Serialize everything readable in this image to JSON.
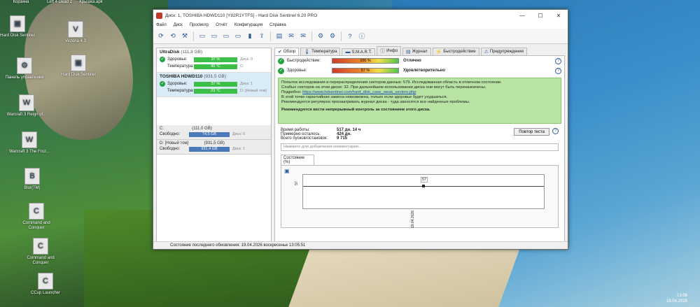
{
  "desktop": {
    "top_labels": [
      "Корзина",
      "Left 4 Dead 2",
      "Крышка.apk"
    ],
    "icons": [
      {
        "label": "Hard Disk Sentinel",
        "glyph": "▣"
      },
      {
        "label": "Victoria 4.3",
        "glyph": "V"
      },
      {
        "label": "Hard Disk Sentinel",
        "glyph": "▣"
      },
      {
        "label": "Панель управления",
        "glyph": "⚙"
      },
      {
        "label": "Warcraft 3 Reign of...",
        "glyph": "W"
      },
      {
        "label": "Warcraft 3 The Froz...",
        "glyph": "W"
      },
      {
        "label": "Blur(TM)",
        "glyph": "B"
      },
      {
        "label": "Command and Conquer",
        "glyph": "C"
      },
      {
        "label": "Command and Conquer",
        "glyph": "C"
      },
      {
        "label": "CCup Launcher",
        "glyph": "C"
      }
    ],
    "clock": {
      "time": "13:06",
      "date": "19.04.2026"
    }
  },
  "window": {
    "title": "Диск: 1, TOSHIBA HDWD110 [Y82R1YTFS] - Hard Disk Sentinel 6.20 PRO",
    "controls": [
      "—",
      "☐",
      "✕"
    ],
    "menu": [
      "Файл",
      "Диск",
      "Просмотр",
      "Отчёт",
      "Конфигурация",
      "Справка"
    ],
    "toolbar_icons": [
      "refresh-icon",
      "refresh-all-icon",
      "tools-icon",
      "disk-icon",
      "disk2-icon",
      "disk3-icon",
      "disk4-icon",
      "chip-icon",
      "usb-icon",
      "report-icon",
      "mail-icon",
      "mail2-icon",
      "gear-icon",
      "settings-icon",
      "help-icon",
      "info-icon"
    ],
    "toolbar_glyphs": [
      "⟳",
      "⟲",
      "⚒",
      "▭",
      "▭",
      "▭",
      "▭",
      "▮",
      "⇪",
      "▤",
      "✉",
      "✉",
      "⚙",
      "⚙",
      "?",
      "ⓘ"
    ]
  },
  "left": {
    "disks": [
      {
        "name": "UltraDisk",
        "size": "(111,8 GB)",
        "health_label": "Здоровье:",
        "health": "97 %",
        "health_ex": "Диск: 0",
        "temp_label": "Температура:",
        "temp": "40 °C",
        "temp_ex": "C:"
      },
      {
        "name": "TOSHIBA HDWD110",
        "size": "(931,5 GB)",
        "health_label": "Здоровье:",
        "health": "57 %",
        "health_ex": "Диск: 1",
        "temp_label": "Температура:",
        "temp": "23 °C",
        "temp_ex": "D: [Новый том]"
      }
    ],
    "partitions": [
      {
        "name": "C:",
        "size": "(111,0 GB)",
        "free_label": "Свободно:",
        "free": "74,5 GB",
        "ex": "Диск: 0"
      },
      {
        "name": "D: [Новый том]",
        "size": "(931,5 GB)",
        "free_label": "Свободно:",
        "free": "931,4 GB",
        "ex": "Диск: 1"
      }
    ]
  },
  "tabs": [
    {
      "label": "Обзор",
      "glyph": "✔"
    },
    {
      "label": "Температура",
      "glyph": "🌡"
    },
    {
      "label": "S.M.A.R.T.",
      "glyph": "▬"
    },
    {
      "label": "Инфо",
      "glyph": "ⓘ"
    },
    {
      "label": "Журнал",
      "glyph": "▤"
    },
    {
      "label": "Быстродействие",
      "glyph": "⚡"
    },
    {
      "label": "Предупреждения",
      "glyph": "⚠"
    }
  ],
  "overview": {
    "performance_label": "Быстродействие:",
    "performance_value": "100 %",
    "performance_fraction": 1.0,
    "performance_status": "Отлично",
    "health_label": "Здоровье:",
    "health_value": "57 %",
    "health_fraction": 0.57,
    "health_status": "Удовлетворительно",
    "message_lines": [
      "Попыток исследования и перераспределения секторов данных: 579. Исследованная область в отличном состоянии.",
      "Слабых секторов на этом диске: 32. При дальнейшем использовании диска они могут быть переназначены.",
      "Подробно: ",
      "В этой точке гарантийная замена невозможна, только если здоровье будет ухудшаться.",
      "Рекомендуется регулярно просматривать журнал диска - туда заносятся все найденные проблемы."
    ],
    "message_link": "https://www.hdsentinel.com/hard_disk_case_weak_sectors.php",
    "message_strong": "Рекомендуется вести непрерывный контроль за состоянием этого диска.",
    "power_on_label": "Время работы:",
    "power_on_value": "517 дн. 14 ч",
    "remaining_label": "Примерно осталось:",
    "remaining_value": "424 дн.",
    "starts_label": "Всего пусков/остановок:",
    "starts_value": "9 715",
    "repeat_test_button": "Повтор теста",
    "comment_placeholder": "Нажмите для добавления комментария...",
    "graph_tab": "Состояние (%)"
  },
  "chart_data": {
    "type": "line",
    "x": [
      "19.04.2026"
    ],
    "series": [
      {
        "values": [
          57
        ]
      }
    ],
    "ylabel": "57",
    "ylim": [
      0,
      100
    ]
  },
  "statusbar": "Состояние последнего обновления: 19.04.2026 воскресенье 13:05:51"
}
